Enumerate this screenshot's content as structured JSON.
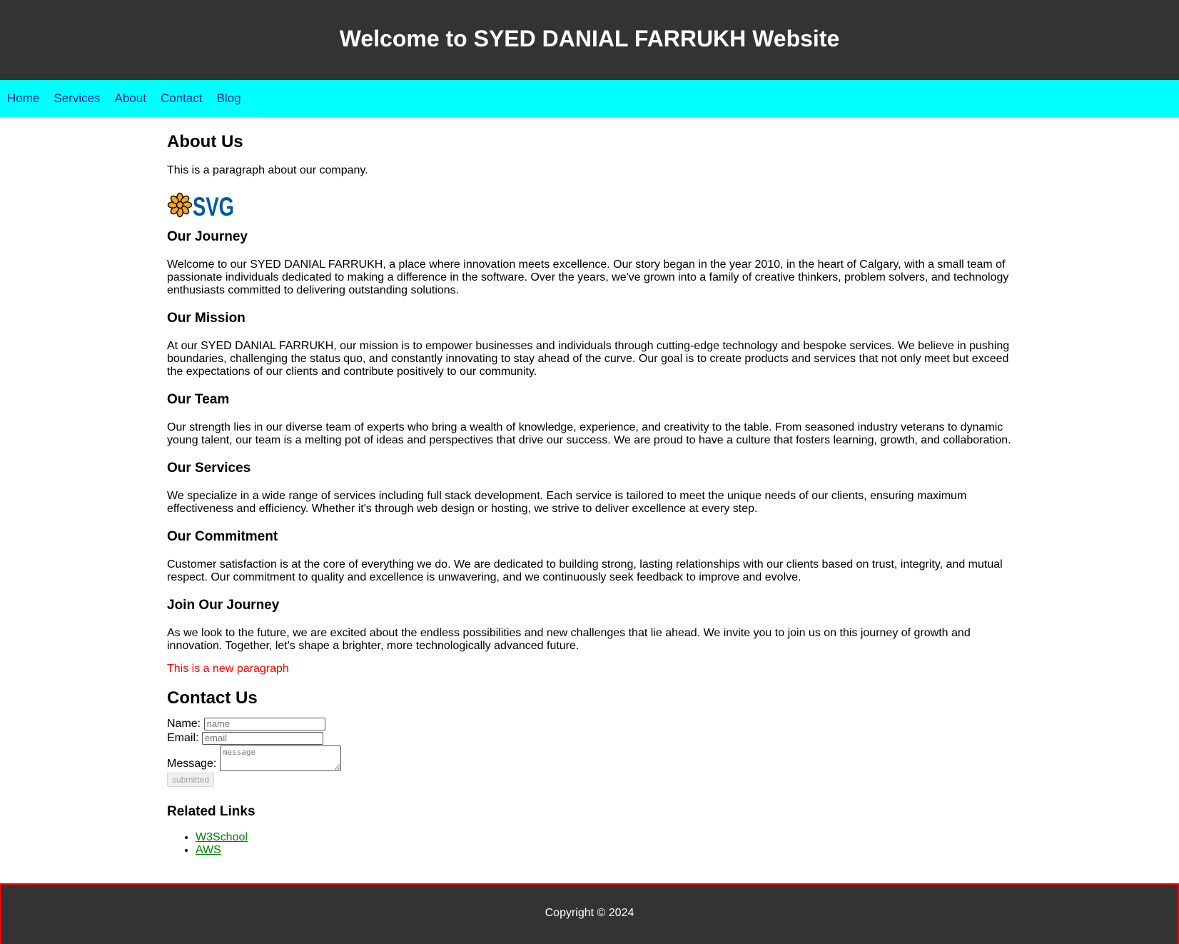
{
  "header": {
    "title": "Welcome to SYED DANIAL FARRUKH Website"
  },
  "nav": {
    "items": [
      "Home",
      "Services",
      "About",
      "Contact",
      "Blog"
    ]
  },
  "about": {
    "title": "About Us",
    "intro": "This is a paragraph about our company.",
    "logo_text": "SVG"
  },
  "sections": [
    {
      "heading": "Our Journey",
      "text": "Welcome to our SYED DANIAL FARRUKH, a place where innovation meets excellence. Our story began in the year 2010, in the heart of Calgary, with a small team of passionate individuals dedicated to making a difference in the software. Over the years, we've grown into a family of creative thinkers, problem solvers, and technology enthusiasts committed to delivering outstanding solutions."
    },
    {
      "heading": "Our Mission",
      "text": "At our SYED DANIAL FARRUKH, our mission is to empower businesses and individuals through cutting-edge technology and bespoke services. We believe in pushing boundaries, challenging the status quo, and constantly innovating to stay ahead of the curve. Our goal is to create products and services that not only meet but exceed the expectations of our clients and contribute positively to our community."
    },
    {
      "heading": "Our Team",
      "text": "Our strength lies in our diverse team of experts who bring a wealth of knowledge, experience, and creativity to the table. From seasoned industry veterans to dynamic young talent, our team is a melting pot of ideas and perspectives that drive our success. We are proud to have a culture that fosters learning, growth, and collaboration."
    },
    {
      "heading": "Our Services",
      "text": "We specialize in a wide range of services including full stack development. Each service is tailored to meet the unique needs of our clients, ensuring maximum effectiveness and efficiency. Whether it's through web design or hosting, we strive to deliver excellence at every step."
    },
    {
      "heading": "Our Commitment",
      "text": "Customer satisfaction is at the core of everything we do. We are dedicated to building strong, lasting relationships with our clients based on trust, integrity, and mutual respect. Our commitment to quality and excellence is unwavering, and we continuously seek feedback to improve and evolve."
    },
    {
      "heading": "Join Our Journey",
      "text": "As we look to the future, we are excited about the endless possibilities and new challenges that lie ahead. We invite you to join us on this journey of growth and innovation. Together, let's shape a brighter, more technologically advanced future."
    }
  ],
  "new_paragraph": "This is a new paragraph",
  "new_paragraph_color": "#ff0000",
  "contact": {
    "title": "Contact Us",
    "name_label": "Name:",
    "name_placeholder": "name",
    "email_label": "Email:",
    "email_placeholder": "email",
    "message_label": "Message:",
    "message_placeholder": "message",
    "submit_label": "submitted"
  },
  "related": {
    "title": "Related Links",
    "links": [
      "W3School",
      "AWS"
    ]
  },
  "footer": {
    "text": "Copyright © 2024"
  },
  "colors": {
    "header_bg": "#333333",
    "nav_bg": "#00ffff",
    "nav_link": "#1a1aa6",
    "link_green": "#008000",
    "footer_border": "#ff0000"
  }
}
